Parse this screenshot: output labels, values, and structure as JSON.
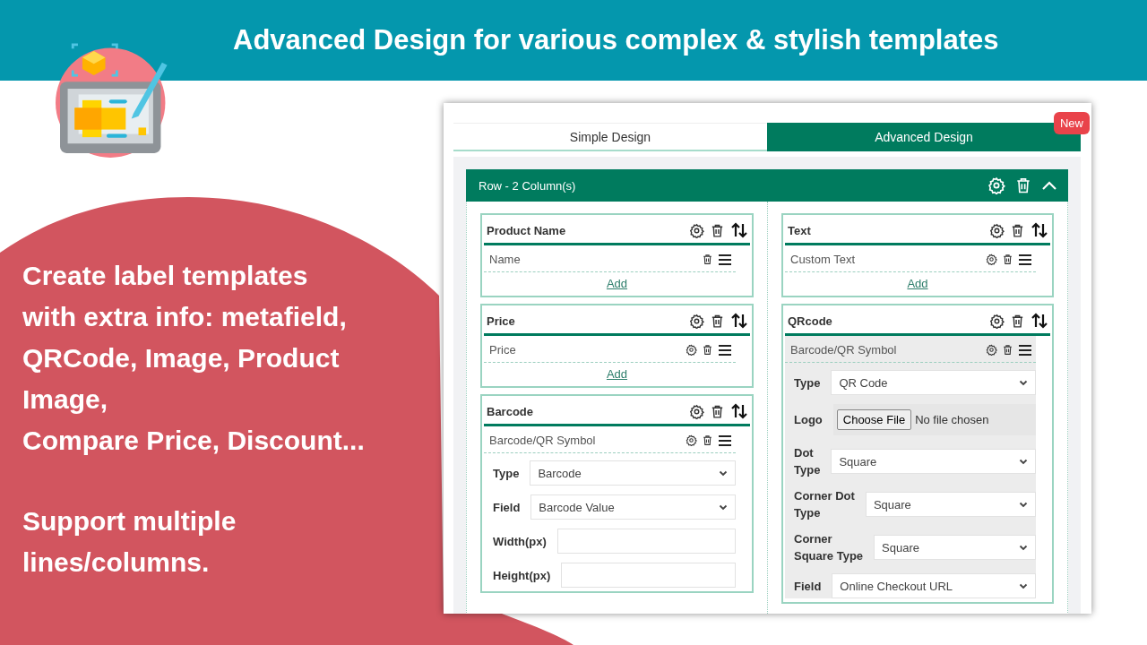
{
  "banner": {
    "title": "Advanced Design for various complex & stylish templates"
  },
  "promo": {
    "paragraphs": [
      {
        "lines": [
          "Create label templates",
          "with extra info: metafield,",
          "QRCode, Image, Product",
          "Image,",
          "Compare Price, Discount..."
        ]
      },
      {
        "lines": [
          "Support multiple",
          "lines/columns."
        ]
      }
    ]
  },
  "editor": {
    "tabs": [
      {
        "label": "Simple Design",
        "selected": false
      },
      {
        "label": "Advanced Design",
        "selected": true
      }
    ],
    "badge": "New",
    "row": {
      "title": "Row - 2 Column(s)",
      "expanded": true
    },
    "columns": [
      [
        {
          "title": "Product Name",
          "items": [
            {
              "label": "Name",
              "settings": false,
              "highlighted": false
            }
          ],
          "add": "Add"
        },
        {
          "title": "Price",
          "items": [
            {
              "label": "Price",
              "settings": true,
              "highlighted": false
            }
          ],
          "add": "Add"
        },
        {
          "title": "Barcode",
          "items": [
            {
              "label": "Barcode/QR Symbol",
              "settings": true,
              "highlighted": false,
              "form": [
                {
                  "kind": "select",
                  "label": "Type",
                  "value": "Barcode"
                },
                {
                  "kind": "select",
                  "label": "Field",
                  "value": "Barcode Value"
                },
                {
                  "kind": "text",
                  "label": "Width(px)"
                },
                {
                  "kind": "text",
                  "label": "Height(px)"
                }
              ]
            }
          ]
        }
      ],
      [
        {
          "title": "Text",
          "items": [
            {
              "label": "Custom Text",
              "settings": true,
              "highlighted": false
            }
          ],
          "add": "Add"
        },
        {
          "title": "QRcode",
          "items": [
            {
              "label": "Barcode/QR Symbol",
              "settings": true,
              "highlighted": true,
              "form": [
                {
                  "kind": "select",
                  "label": "Type",
                  "value": "QR Code"
                },
                {
                  "kind": "file",
                  "label": "Logo",
                  "button": "Choose File",
                  "value": "No file chosen"
                },
                {
                  "kind": "select",
                  "label": "Dot\nType",
                  "value": "Square"
                },
                {
                  "kind": "select",
                  "label": "Corner Dot\nType",
                  "value": "Square"
                },
                {
                  "kind": "select",
                  "label": "Corner\nSquare Type",
                  "value": "Square"
                },
                {
                  "kind": "select",
                  "label": "Field",
                  "value": "Online Checkout URL"
                }
              ]
            }
          ]
        }
      ]
    ]
  }
}
